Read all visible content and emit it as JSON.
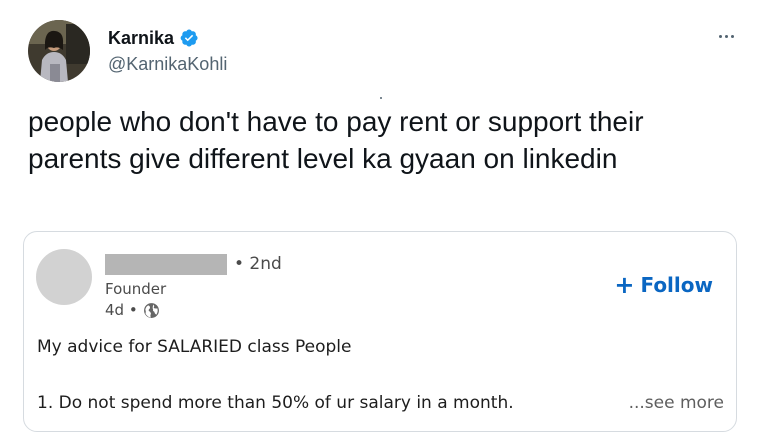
{
  "tweet": {
    "display_name": "Karnika",
    "handle": "@KarnikaKohli",
    "verified_icon": "verified-badge-icon",
    "more_icon": "more-options-icon",
    "text_line1": "people who don't have to pay rent or support their",
    "text_line2": "parents give different level ka gyaan on linkedin"
  },
  "linkedin_card": {
    "connection_degree": "• 2nd",
    "headline": "Founder",
    "post_age": "4d •",
    "visibility_icon": "globe-icon",
    "follow_label": "Follow",
    "follow_icon": "plus",
    "post_line1": "My advice for SALARIED class People",
    "post_line2": "1. Do not spend more than 50% of ur salary in a month.",
    "see_more": "...see more"
  },
  "colors": {
    "text_primary": "#0f1419",
    "text_secondary": "#536471",
    "verified_blue": "#1d9bf0",
    "linkedin_blue": "#0a66c2",
    "card_border": "#d6dbe0",
    "redaction_gray": "#b5b5b5"
  }
}
